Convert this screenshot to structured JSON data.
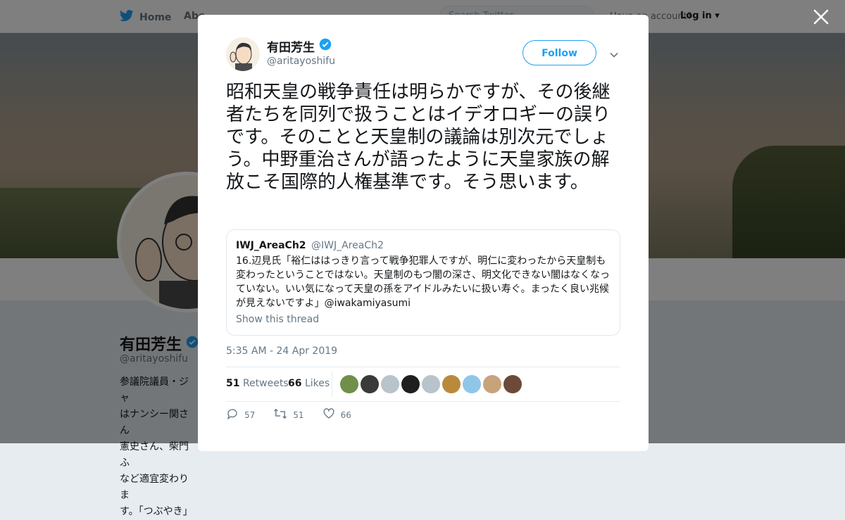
{
  "topbar": {
    "home_label": "Home",
    "about_label": "Abo",
    "search_placeholder": "Search Twitter",
    "account_text": "Have an account?",
    "login_label": "Log in"
  },
  "profile": {
    "name": "有田芳生",
    "handle": "@aritayoshifu",
    "bio": "参議院議員・ジャ\nはナンシー関さん\n憲史さん、柴門ふ\nなど適宜変わりま\nす。「つぶやき」"
  },
  "tweet": {
    "author_name": "有田芳生",
    "author_handle": "@aritayoshifu",
    "follow_label": "Follow",
    "text": "昭和天皇の戦争責任は明らかですが、その後継者たちを同列で扱うことはイデオロギーの誤りです。そのことと天皇制の議論は別次元でしょう。中野重治さんが語ったように天皇家族の解放こそ国際的人権基準です。そう思います。",
    "quote": {
      "name": "IWJ_AreaCh2",
      "handle": "@IWJ_AreaCh2",
      "text": "16.辺見氏「裕仁ははっきり言って戦争犯罪人ですが、明仁に変わったから天皇制も変わったということではない。天皇制のもつ闇の深さ、明文化できない闇はなくなっていない。いい気になって天皇の孫をアイドルみたいに扱い寿ぐ。まったく良い兆候が見えないですよ」@iwakamiyasumi",
      "show_thread": "Show this thread"
    },
    "timestamp": "5:35 AM - 24 Apr 2019",
    "retweets_count": "51",
    "retweets_label": "Retweets",
    "likes_count": "66",
    "likes_label": "Likes",
    "actions": {
      "reply_count": "57",
      "retweet_count": "51",
      "like_count": "66"
    }
  },
  "likers": [
    {
      "color": "#6f8f4a"
    },
    {
      "color": "#3a3a3a"
    },
    {
      "color": "#b8c3cb"
    },
    {
      "color": "#1f1f1f"
    },
    {
      "color": "#b8c3cb"
    },
    {
      "color": "#b98a3c"
    },
    {
      "color": "#8fc6e8"
    },
    {
      "color": "#c8a27a"
    },
    {
      "color": "#6b4a3a"
    }
  ],
  "colors": {
    "accent": "#1da1f2",
    "text": "#14171a",
    "muted": "#657786"
  }
}
